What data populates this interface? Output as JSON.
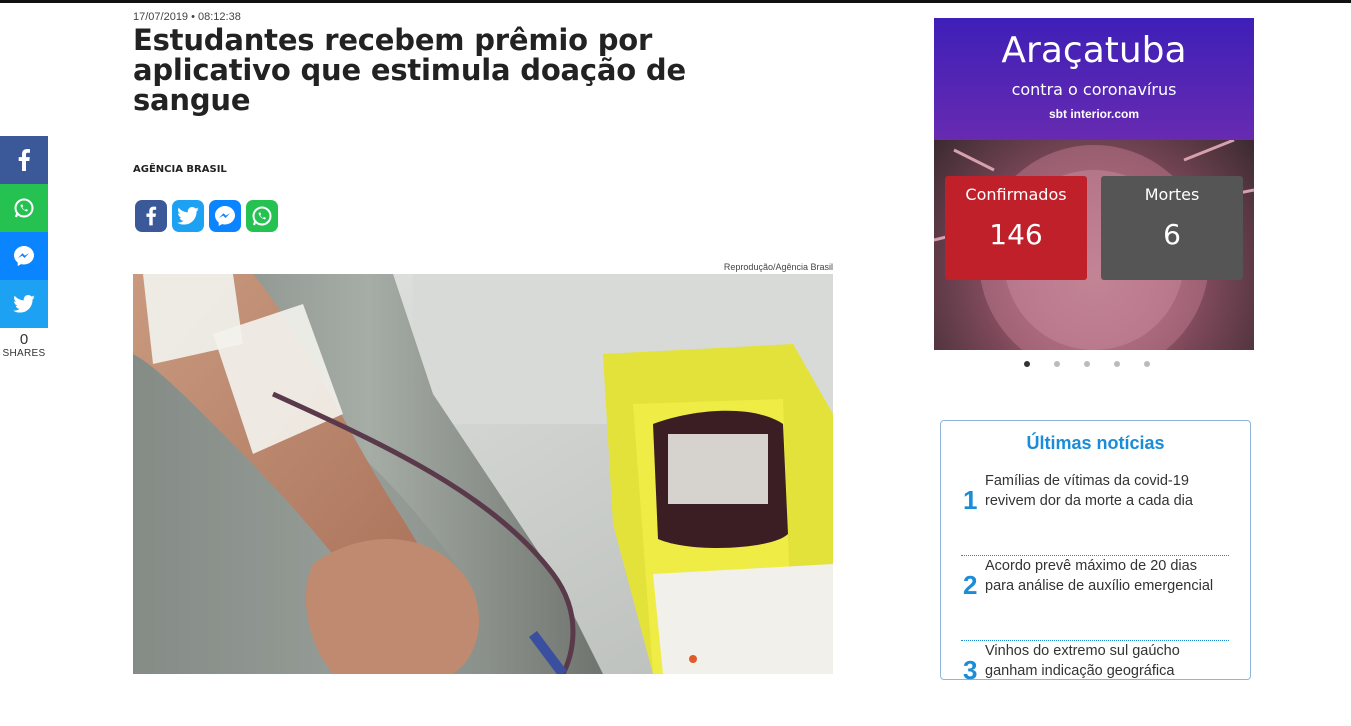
{
  "article": {
    "date": "17/07/2019 • 08:12:38",
    "headline": "Estudantes recebem prêmio por aplicativo que estimula doação de sangue",
    "author": "AGÊNCIA BRASIL",
    "photo_credit": "Reprodução/Agência Brasil"
  },
  "share_rail": {
    "count": "0",
    "label": "SHARES"
  },
  "banner": {
    "city": "Araçatuba",
    "subtitle": "contra o coronavírus",
    "logo_text": "sbt interior.com",
    "confirmed_label": "Confirmados",
    "confirmed_value": "146",
    "deaths_label": "Mortes",
    "deaths_value": "6"
  },
  "carousel": {
    "count": 5,
    "active": 1
  },
  "latest_news": {
    "title": "Últimas notícias",
    "items": [
      {
        "num": "1",
        "text": "Famílias de vítimas da covid-19 revivem dor da morte a cada dia"
      },
      {
        "num": "2",
        "text": "Acordo prevê máximo de 20 dias para análise de auxílio emergencial"
      },
      {
        "num": "3",
        "text": "Vinhos do extremo sul gaúcho ganham indicação geográfica"
      }
    ]
  },
  "colors": {
    "facebook": "#3b5998",
    "whatsapp": "#25c252",
    "messenger": "#0a84ff",
    "twitter": "#1da1f2",
    "accent": "#1a8cd8",
    "confirmed": "#c0202a",
    "deaths": "#555555"
  }
}
